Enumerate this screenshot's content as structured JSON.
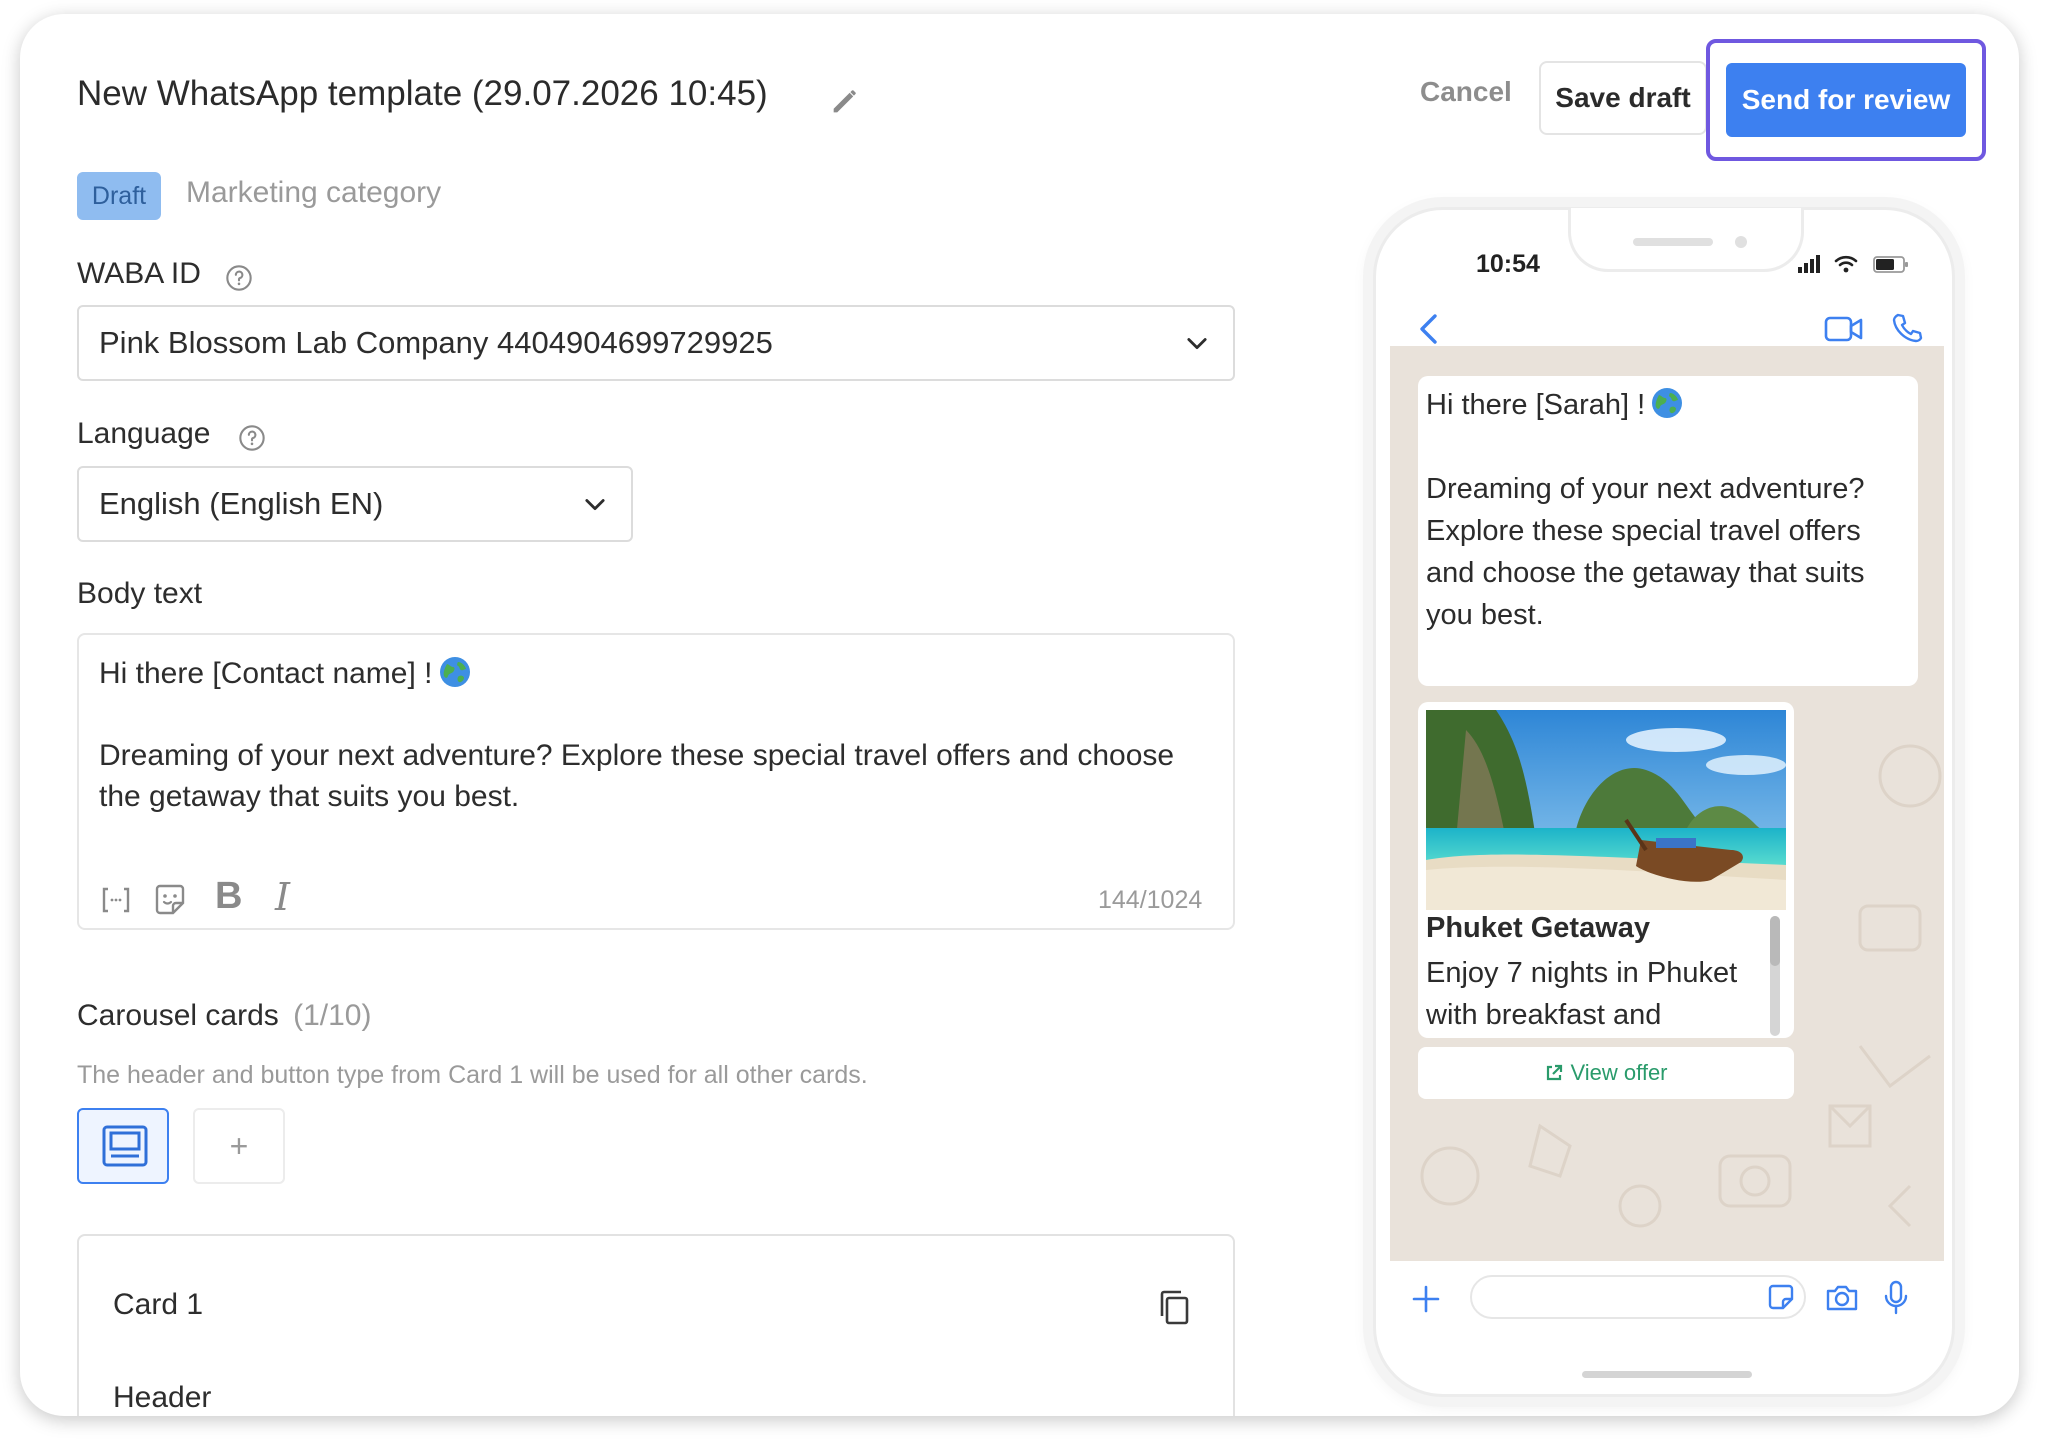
{
  "header": {
    "title": "New WhatsApp template (29.07.2026 10:45)",
    "cancel_label": "Cancel",
    "save_draft_label": "Save draft",
    "send_label": "Send for review"
  },
  "status": {
    "badge": "Draft",
    "category": "Marketing category"
  },
  "waba": {
    "label": "WABA ID",
    "value": "Pink Blossom Lab Company 4404904699729925"
  },
  "language": {
    "label": "Language",
    "value": "English (English EN)"
  },
  "body": {
    "label": "Body text",
    "line1": "Hi there [Contact name] !",
    "paragraph": "Dreaming of your next adventure? Explore these special travel offers and choose the getaway that suits you best.",
    "counter": "144/1024"
  },
  "carousel": {
    "label": "Carousel cards",
    "count": "(1/10)",
    "hint": "The header and button type from Card 1 will be used for all other cards.",
    "add_symbol": "+"
  },
  "card1": {
    "title": "Card 1",
    "header_label": "Header"
  },
  "preview": {
    "time": "10:54",
    "greeting": "Hi there [Sarah] !",
    "paragraph": "Dreaming of your next adventure? Explore these special travel offers and choose the getaway that suits you best.",
    "card_title": "Phuket Getaway",
    "card_desc": "Enjoy 7 nights in Phuket with breakfast and",
    "button_label": "View offer"
  },
  "colors": {
    "primary": "#3d80f0",
    "highlight": "#6f58e0",
    "badge_bg": "#8fbcf0",
    "link_green": "#2a9b6b",
    "chat_bg": "#e9e2da"
  },
  "icons": [
    "pencil-icon",
    "help-icon",
    "chevron-down-icon",
    "globe-icon",
    "variable-icon",
    "emoji-icon",
    "bold-icon",
    "italic-icon",
    "card-layout-icon",
    "copy-icon",
    "back-icon",
    "video-icon",
    "phone-call-icon",
    "plus-icon",
    "sticker-icon",
    "camera-icon",
    "mic-icon",
    "external-link-icon"
  ]
}
